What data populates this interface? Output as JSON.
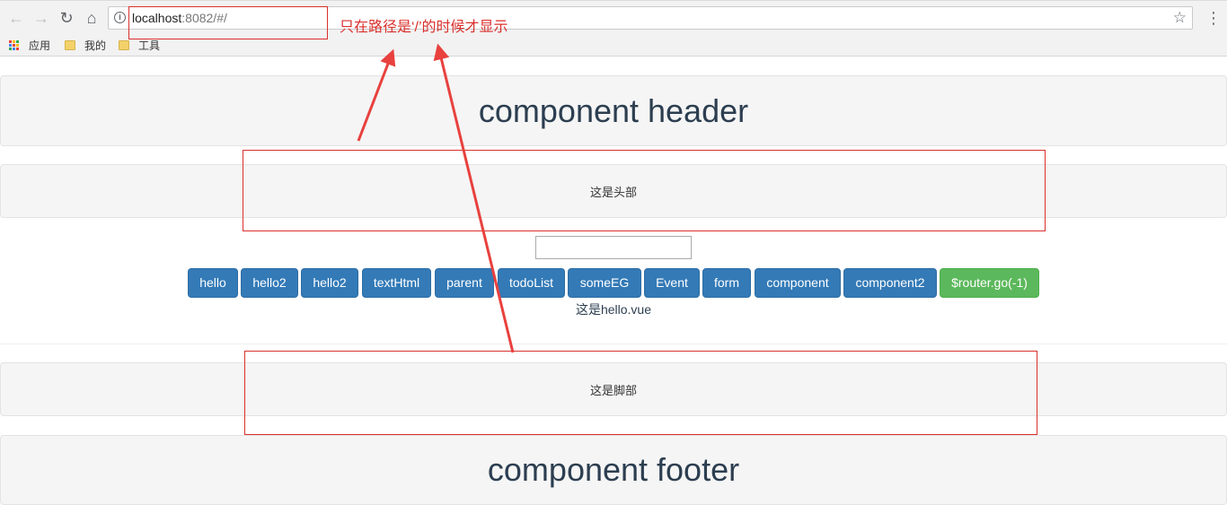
{
  "browser": {
    "url_host": "localhost",
    "url_rest": ":8082/#/",
    "nav": {
      "back": "←",
      "forward": "→",
      "reload": "↻",
      "home": "⌂",
      "star": "☆",
      "menu": "⋮",
      "info": "i"
    },
    "bookmarks": [
      {
        "label": "应用",
        "icon": "apps-icon"
      },
      {
        "label": "我的",
        "icon": "folder-icon"
      },
      {
        "label": "工具",
        "icon": "folder-icon"
      }
    ]
  },
  "page": {
    "header_component": "component header",
    "header": "这是头部",
    "buttons": [
      {
        "label": "hello",
        "type": "primary"
      },
      {
        "label": "hello2",
        "type": "primary"
      },
      {
        "label": "hello2",
        "type": "primary"
      },
      {
        "label": "textHtml",
        "type": "primary"
      },
      {
        "label": "parent",
        "type": "primary"
      },
      {
        "label": "todoList",
        "type": "primary"
      },
      {
        "label": "someEG",
        "type": "primary"
      },
      {
        "label": "Event",
        "type": "primary"
      },
      {
        "label": "form",
        "type": "primary"
      },
      {
        "label": "component",
        "type": "primary"
      },
      {
        "label": "component2",
        "type": "primary"
      },
      {
        "label": "$router.go(-1)",
        "type": "success"
      }
    ],
    "hello_text": "这是hello.vue",
    "footer": "这是脚部",
    "footer_component": "component footer"
  },
  "annotation": {
    "text": "只在路径是‘/’的时候才显示",
    "color": "#d9302c"
  },
  "colors": {
    "primary": "#337ab7",
    "success": "#5cb85c",
    "title": "#2c3e50",
    "panel": "#f5f5f5"
  }
}
